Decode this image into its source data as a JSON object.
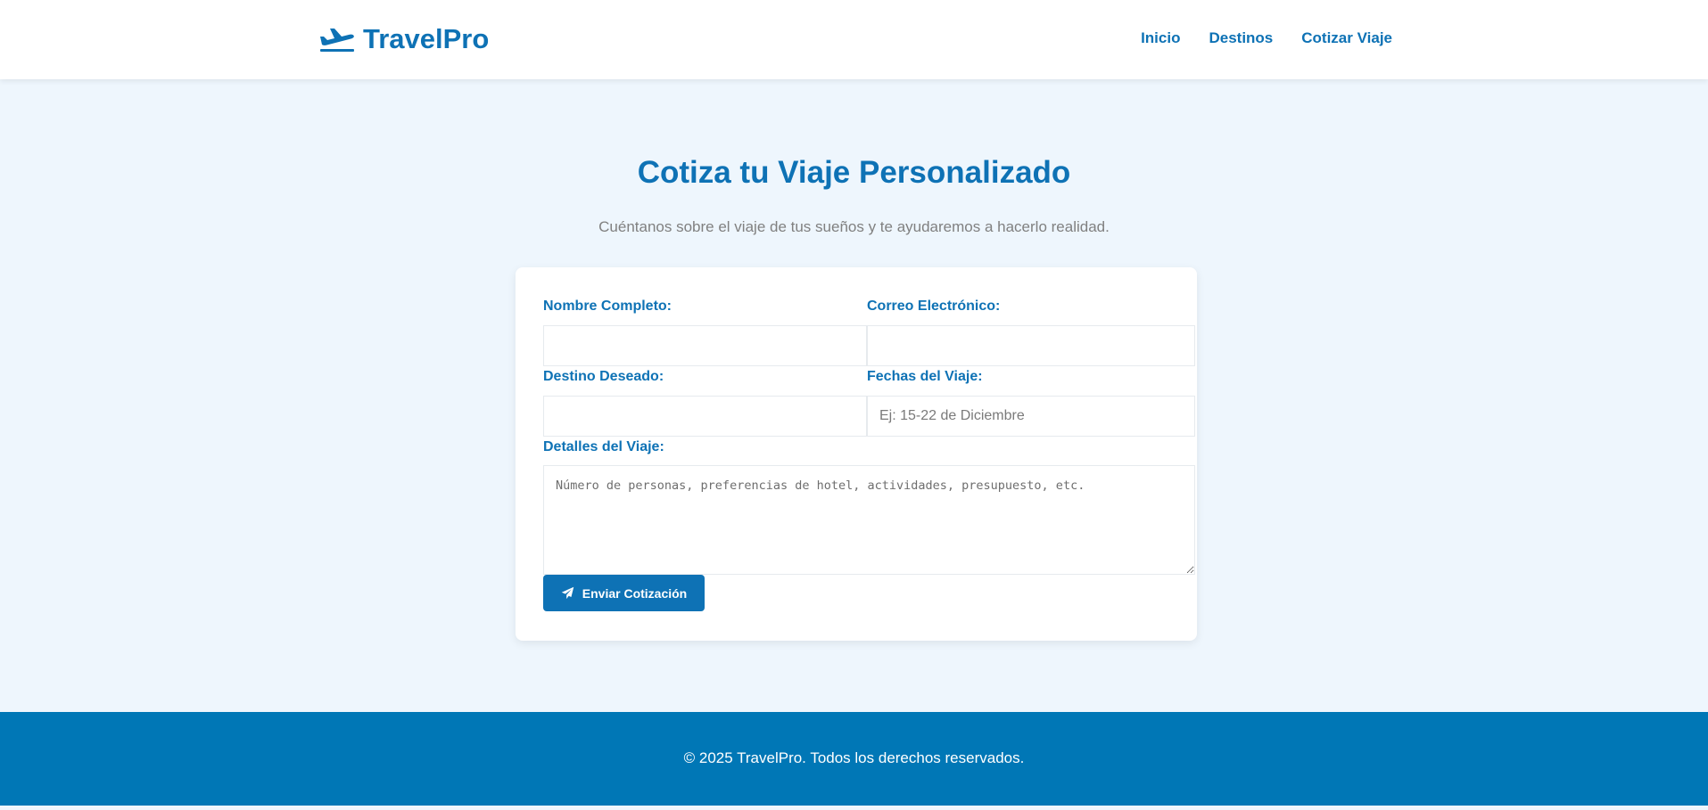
{
  "header": {
    "brand": "TravelPro",
    "logo_icon": "plane-departure-icon",
    "nav": [
      {
        "label": "Inicio"
      },
      {
        "label": "Destinos"
      },
      {
        "label": "Cotizar Viaje"
      }
    ]
  },
  "hero": {
    "title": "Cotiza tu Viaje Personalizado",
    "subtitle": "Cuéntanos sobre el viaje de tus sueños y te ayudaremos a hacerlo realidad."
  },
  "form": {
    "name_label": "Nombre Completo:",
    "name_value": "",
    "name_placeholder": "",
    "email_label": "Correo Electrónico:",
    "email_value": "",
    "email_placeholder": "",
    "destination_label": "Destino Deseado:",
    "destination_value": "",
    "destination_placeholder": "",
    "dates_label": "Fechas del Viaje:",
    "dates_value": "",
    "dates_placeholder": "Ej: 15-22 de Diciembre",
    "details_label": "Detalles del Viaje:",
    "details_value": "",
    "details_placeholder": "Número de personas, preferencias de hotel, actividades, presupuesto, etc.",
    "submit_label": "Enviar Cotización",
    "submit_icon": "paper-plane-icon"
  },
  "footer": {
    "text": "© 2025 TravelPro. Todos los derechos reservados."
  },
  "colors": {
    "primary": "#0e72b5",
    "footer_bg": "#0077b6",
    "page_bg": "#eef6fd",
    "muted_text": "#808080"
  }
}
